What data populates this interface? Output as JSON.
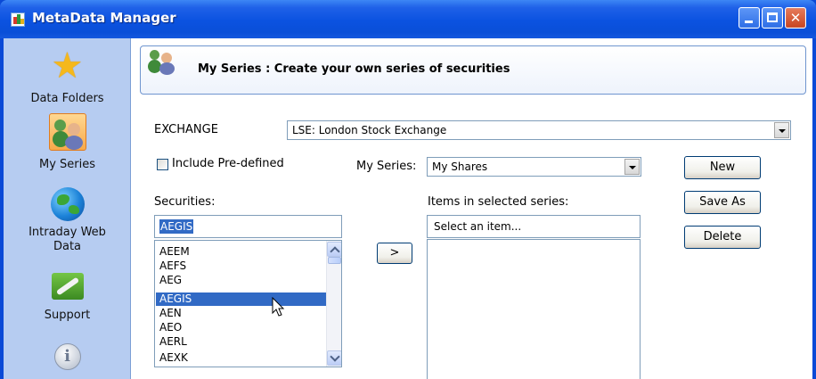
{
  "window": {
    "title": "MetaData Manager",
    "controls": {
      "minimize": "",
      "maximize": "",
      "close": "✕"
    }
  },
  "sidebar": {
    "items": [
      {
        "label": "Data Folders",
        "icon": "star-icon"
      },
      {
        "label": "My Series",
        "icon": "people-icon",
        "selected": true
      },
      {
        "label": "Intraday Web Data",
        "icon": "globe-icon"
      },
      {
        "label": "Support",
        "icon": "wrench-icon"
      },
      {
        "label": "",
        "icon": "info-icon"
      }
    ]
  },
  "header": {
    "title": "My Series : Create your own series of securities",
    "icon": "people-icon"
  },
  "form": {
    "exchange_label": "EXCHANGE",
    "exchange_value": "LSE: London Stock Exchange",
    "include_predefined_label": "Include Pre-defined",
    "include_predefined_checked": false,
    "my_series_label": "My Series:",
    "my_series_value": "My Shares",
    "securities_label": "Securities:",
    "securities_search": "AEGIS",
    "securities_list": [
      "AEEM",
      "AEFS",
      "AEG",
      "AEGIS",
      "AEN",
      "AEO",
      "AERL",
      "AEXK"
    ],
    "securities_selected": "AEGIS",
    "move_button": ">",
    "items_label": "Items in selected series:",
    "items_placeholder": "Select an item..."
  },
  "buttons": {
    "new": "New",
    "save_as": "Save As",
    "delete": "Delete"
  },
  "colors": {
    "title_bar": "#0a4fd8",
    "sidebar_bg": "#b6ccf1",
    "selection": "#316ac5",
    "my_series_icon_bg": "#f7a94a"
  }
}
